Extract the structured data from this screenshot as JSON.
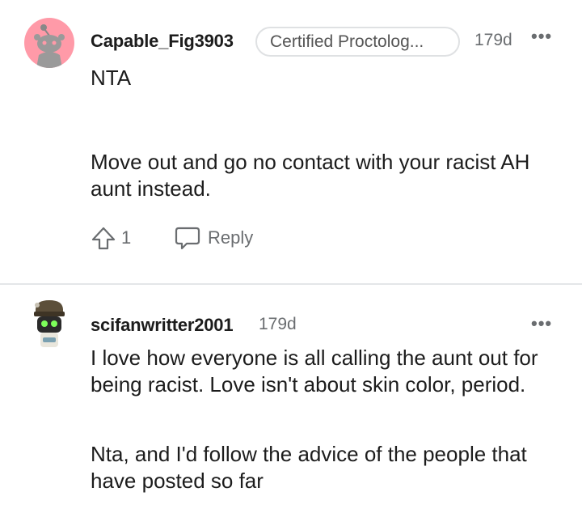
{
  "comments": [
    {
      "username": "Capable_Fig3903",
      "flair": "Certified Proctolog...",
      "age": "179d",
      "paragraphs": [
        "NTA",
        "Move out and go no contact with your racist AH aunt instead."
      ],
      "vote_count": "1",
      "reply_label": "Reply",
      "more_label": "•••"
    },
    {
      "username": "scifanwritter2001",
      "age": "179d",
      "paragraphs": [
        "I love how everyone is all calling the aunt out for being racist. Love isn't about skin color, period.",
        "Nta, and I'd follow the advice of the people that have posted so far"
      ],
      "more_label": "•••"
    }
  ],
  "colors": {
    "avatar_bg": "#ff9aa8",
    "meta_text": "#6a6d70",
    "divider": "#e4e6e8"
  }
}
